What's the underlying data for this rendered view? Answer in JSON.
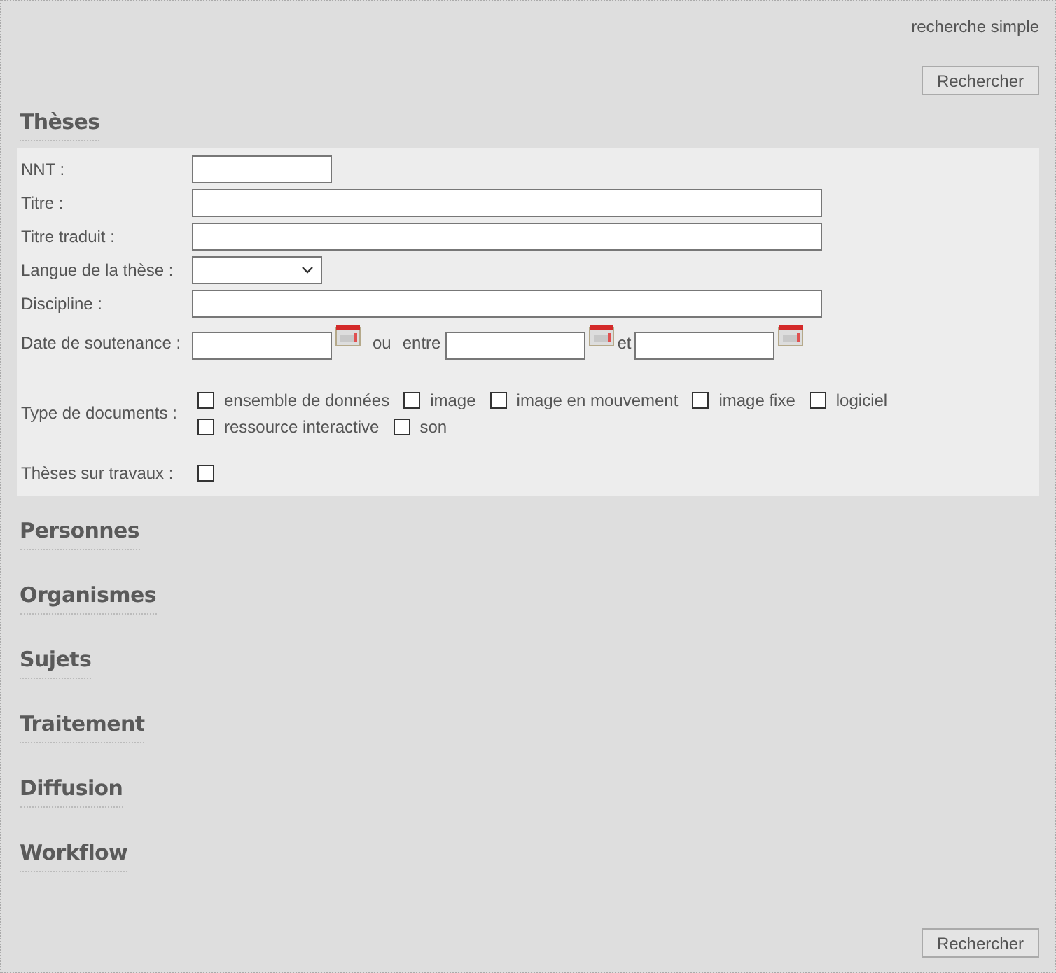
{
  "header": {
    "link": "recherche simple",
    "button": "Rechercher"
  },
  "sections": [
    {
      "title": "Thèses",
      "fields": [
        {
          "kind": "shorttext",
          "label": "NNT :"
        },
        {
          "kind": "text",
          "label": "Titre :"
        },
        {
          "kind": "text",
          "label": "Titre traduit :"
        },
        {
          "kind": "select",
          "label": "Langue de la thèse :"
        },
        {
          "kind": "text",
          "label": "Discipline :"
        },
        {
          "kind": "date",
          "label": "Date de soutenance :",
          "or": "ou",
          "between": "entre",
          "and": "et"
        },
        {
          "kind": "checkgroup",
          "label": "Type de documents :",
          "options": [
            {
              "label": "ensemble de données",
              "checked": false
            },
            {
              "label": "image",
              "checked": false
            },
            {
              "label": "image en mouvement",
              "checked": false
            },
            {
              "label": "image fixe",
              "checked": false
            },
            {
              "label": "logiciel",
              "checked": false
            },
            {
              "label": "ressource interactive",
              "checked": false
            },
            {
              "label": "son",
              "checked": false
            }
          ]
        },
        {
          "kind": "check",
          "label": "Thèses sur travaux :",
          "checked": false
        }
      ]
    },
    {
      "title": "Personnes"
    },
    {
      "title": "Organismes"
    },
    {
      "title": "Sujets"
    },
    {
      "title": "Traitement"
    },
    {
      "title": "Diffusion"
    },
    {
      "title": "Workflow"
    }
  ],
  "footer": {
    "button": "Rechercher"
  }
}
